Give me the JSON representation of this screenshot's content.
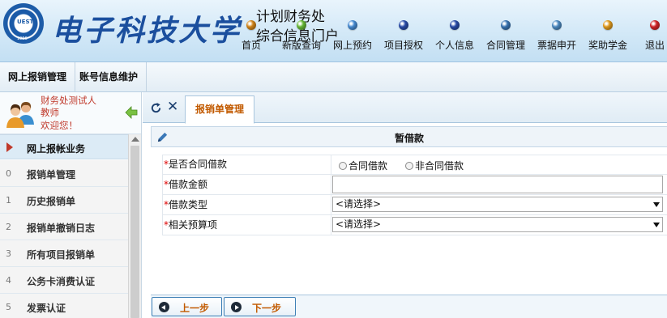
{
  "header": {
    "university_name": "电子科技大学",
    "site_title_line1": "计划财务处",
    "site_title_line2": "综合信息门户",
    "seal_text": "UESTC",
    "seal_year": "1956",
    "nav": [
      {
        "label": "首页",
        "dot_color": "#d98a1c"
      },
      {
        "label": "新版查询",
        "dot_color": "#6cbf3a"
      },
      {
        "label": "网上预约",
        "dot_color": "#4a90d9"
      },
      {
        "label": "项目授权",
        "dot_color": "#2b4fae"
      },
      {
        "label": "个人信息",
        "dot_color": "#2b4fae"
      },
      {
        "label": "合同管理",
        "dot_color": "#3a78b8"
      },
      {
        "label": "票据申开",
        "dot_color": "#4f8fc8"
      },
      {
        "label": "奖助学金",
        "dot_color": "#e8a020"
      },
      {
        "label": "退出",
        "dot_color": "#d9262a"
      }
    ]
  },
  "top_tabs": [
    {
      "label": "网上报销管理"
    },
    {
      "label": "账号信息维护"
    }
  ],
  "sidebar": {
    "user_name": "财务处测试人",
    "user_role": "教师",
    "welcome": "欢迎您！",
    "menu_header": "网上报帐业务",
    "items": [
      {
        "num": "0",
        "label": "报销单管理"
      },
      {
        "num": "1",
        "label": "历史报销单"
      },
      {
        "num": "2",
        "label": "报销单撤销日志"
      },
      {
        "num": "3",
        "label": "所有项目报销单"
      },
      {
        "num": "4",
        "label": "公务卡消费认证"
      },
      {
        "num": "5",
        "label": "发票认证"
      }
    ]
  },
  "main": {
    "tab_label": "报销单管理",
    "panel_title": "暂借款",
    "fields": {
      "contract_label": "是否合同借款",
      "contract_options": [
        "合同借款",
        "非合同借款"
      ],
      "amount_label": "借款金额",
      "amount_value": "",
      "type_label": "借款类型",
      "type_selected": "<请选择>",
      "budget_label": "相关预算项",
      "budget_selected": "<请选择>"
    },
    "prev_button": "上一步",
    "next_button": "下一步"
  },
  "colors": {
    "brand_blue": "#1b4f9e",
    "accent_orange": "#c25a00",
    "required_red": "#d00000",
    "user_text_red": "#c0392b"
  }
}
